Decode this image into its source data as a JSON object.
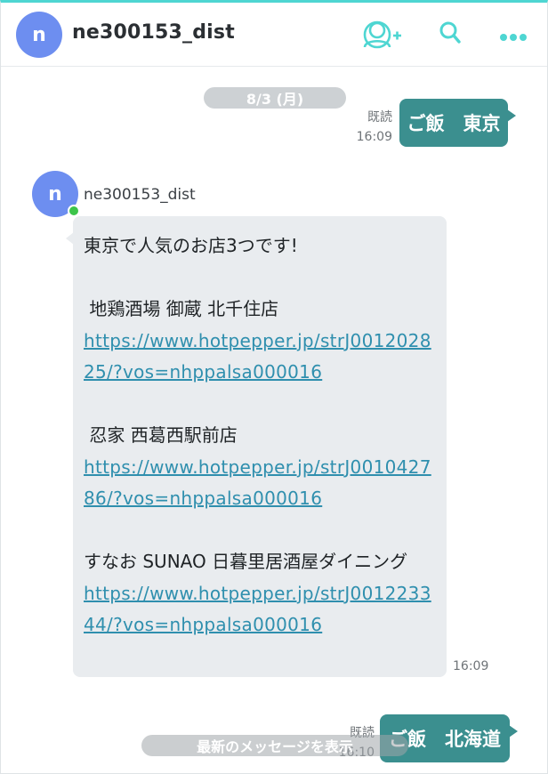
{
  "header": {
    "avatar_initial": "n",
    "title": "ne300153_dist",
    "icons": [
      "add-friend-icon",
      "search-icon",
      "more-icon"
    ]
  },
  "date_separator": "8/3 (月)",
  "messages": [
    {
      "type": "sent",
      "text": "ご飯　東京",
      "read_label": "既読",
      "time": "16:09"
    },
    {
      "type": "received",
      "sender": "ne300153_dist",
      "avatar_initial": "n",
      "lines": [
        "東京で人気のお店3つです!",
        "",
        " 地鶏酒場 御蔵 北千住店",
        "https://www.hotpepper.jp/strJ001202825/?vos=nhppalsa000016",
        "",
        " 忍家 西葛西駅前店",
        "https://www.hotpepper.jp/strJ001042786/?vos=nhppalsa000016",
        "",
        " すなお SUNAO 日暮里居酒屋ダイニング",
        "https://www.hotpepper.jp/strJ001223344/?vos=nhppalsa000016"
      ],
      "time": "16:09"
    },
    {
      "type": "sent",
      "text": "ご飯　北海道",
      "read_label": "既読",
      "time": "16:10"
    }
  ],
  "latest_button": "最新のメッセージを表示",
  "colors": {
    "accent_top": "#4ed6d2",
    "sent_bubble": "#3b8f8f",
    "recv_bubble": "#e9ecef",
    "link": "#2f8fae",
    "avatar": "#6d8ef0",
    "online": "#3cc44a"
  }
}
